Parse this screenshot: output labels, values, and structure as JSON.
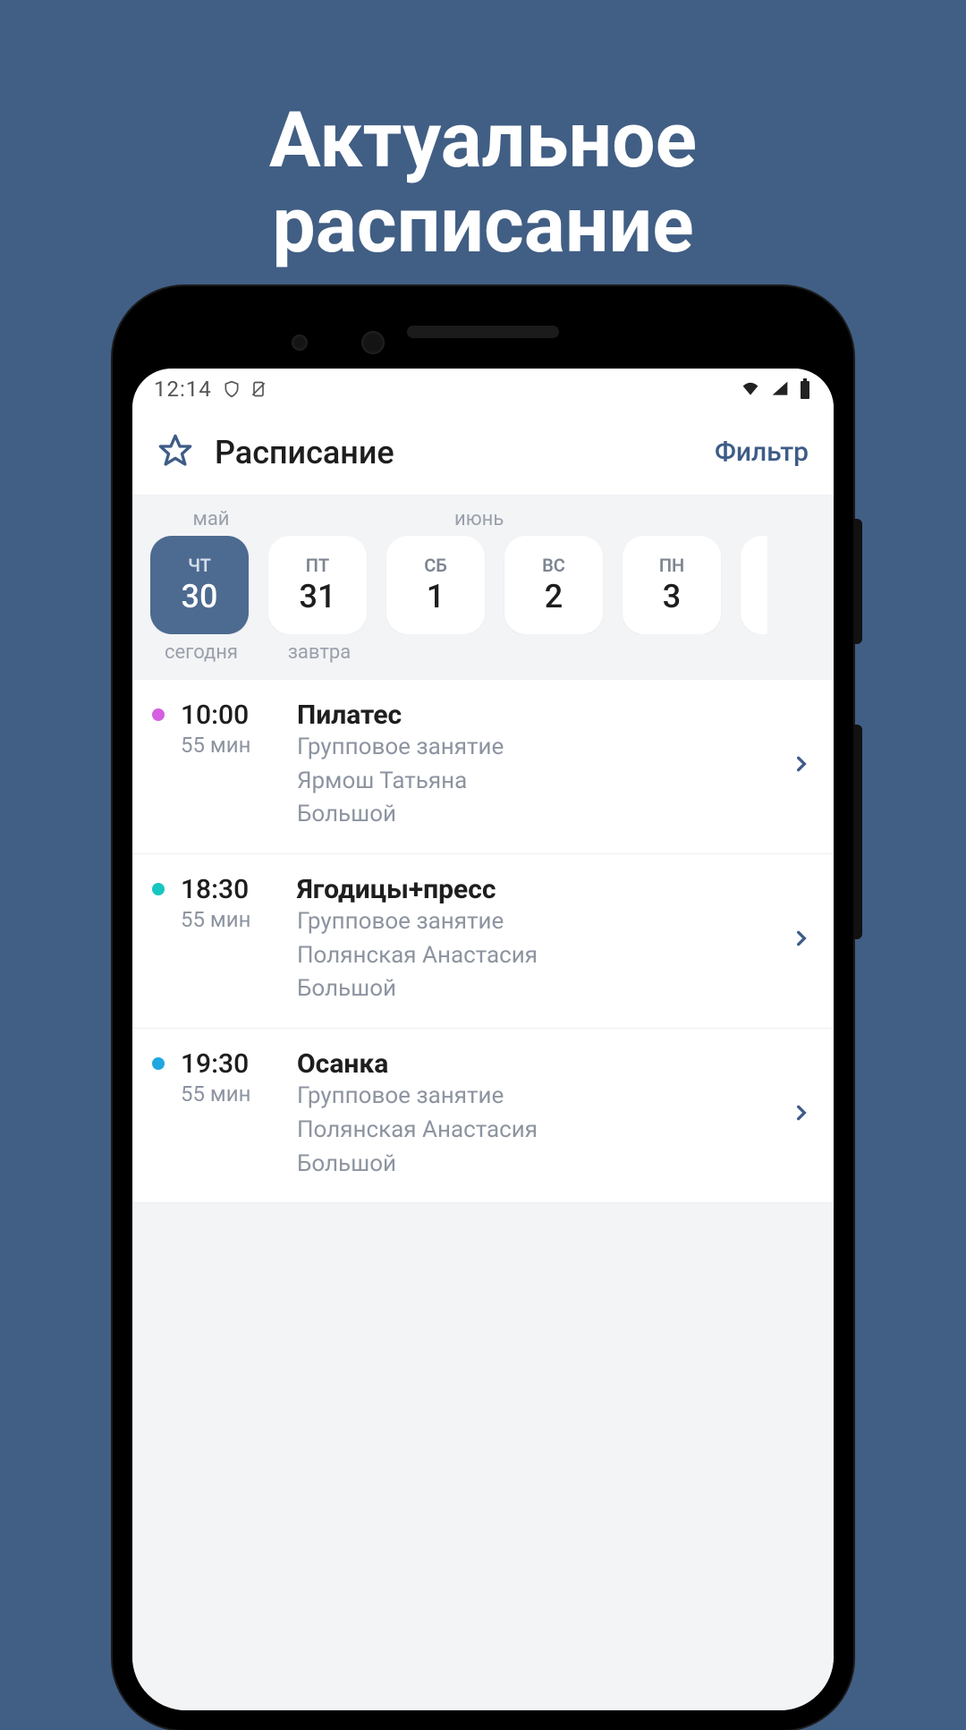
{
  "promo": {
    "line1": "Актуальное",
    "line2": "расписание"
  },
  "statusbar": {
    "time": "12:14"
  },
  "appbar": {
    "title": "Расписание",
    "filter": "Фильтр"
  },
  "calendar": {
    "month1": "май",
    "month2": "июнь",
    "days": [
      {
        "dow": "ЧТ",
        "num": "30",
        "active": true,
        "label": "сегодня"
      },
      {
        "dow": "ПТ",
        "num": "31",
        "active": false,
        "label": "завтра"
      },
      {
        "dow": "СБ",
        "num": "1",
        "active": false,
        "label": ""
      },
      {
        "dow": "ВС",
        "num": "2",
        "active": false,
        "label": ""
      },
      {
        "dow": "ПН",
        "num": "3",
        "active": false,
        "label": ""
      }
    ]
  },
  "classes": [
    {
      "dot_color": "#d55fe0",
      "time": "10:00",
      "duration": "55 мин",
      "name": "Пилатес",
      "type": "Групповое занятие",
      "trainer": "Ярмош Татьяна",
      "room": "Большой"
    },
    {
      "dot_color": "#17c6c0",
      "time": "18:30",
      "duration": "55 мин",
      "name": "Ягодицы+пресс",
      "type": "Групповое занятие",
      "trainer": "Полянская Анастасия",
      "room": "Большой"
    },
    {
      "dot_color": "#1fa8e0",
      "time": "19:30",
      "duration": "55 мин",
      "name": "Осанка",
      "type": "Групповое занятие",
      "trainer": "Полянская Анастасия",
      "room": "Большой"
    }
  ]
}
